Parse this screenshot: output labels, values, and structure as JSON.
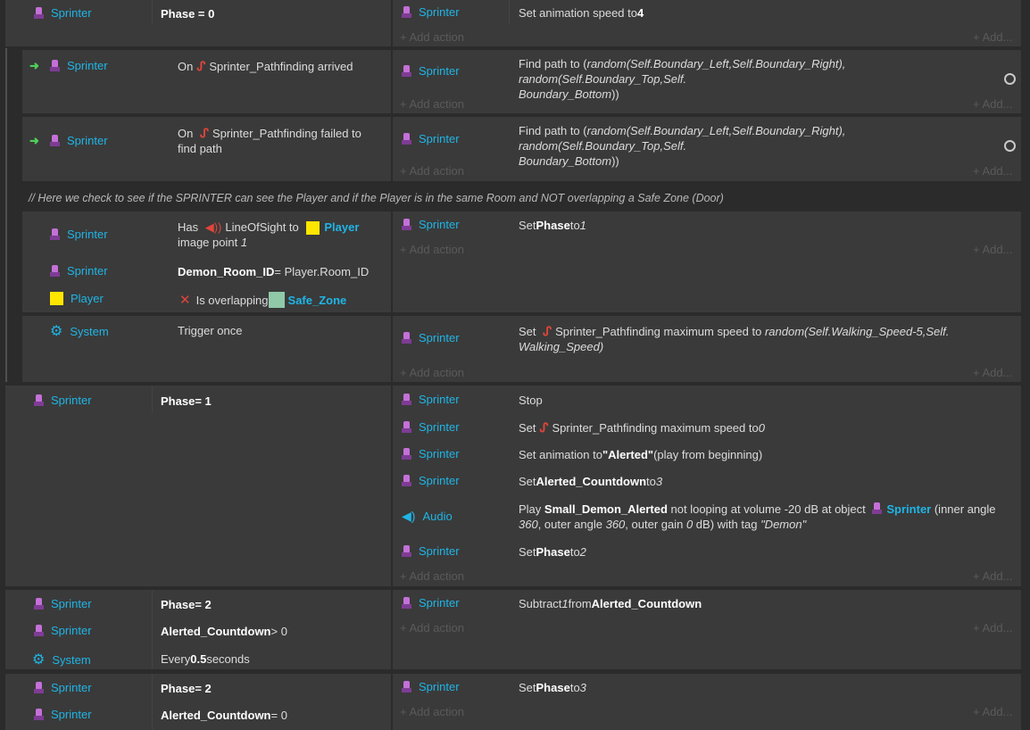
{
  "add_action": "+ Add action",
  "add_more": "+ Add...",
  "comment": "//  Here we check to see if the SPRINTER can see the Player and if the Player is in the same Room and NOT overlapping a Safe Zone (Door)",
  "objects": {
    "sprinter": "Sprinter",
    "player": "Player",
    "system": "System",
    "audio": "Audio"
  },
  "ev1": {
    "cond": "Phase = 0",
    "act": "Set animation speed to ",
    "act_val": "4"
  },
  "ev2": {
    "cond_pre": "On ",
    "cond_name": "Sprinter_Pathfinding arrived",
    "act": "Find path to (",
    "act_expr": "random(Self.Boundary_Left,Self.Boundary_Right), random(Self.Boundary_Top,Self.",
    "act_expr2": "Boundary_Bottom",
    "act_end": "))"
  },
  "ev3": {
    "cond_pre": "On ",
    "cond_name": "Sprinter_Pathfinding failed to",
    "cond_line2": "find path",
    "act": "Find path to (",
    "act_expr": "random(Self.Boundary_Left,Self.Boundary_Right), random(Self.Boundary_Top,Self.",
    "act_expr2": "Boundary_Bottom",
    "act_end": "))"
  },
  "ev4": {
    "c1_pre": "Has ",
    "c1_beh": "LineOfSight to ",
    "c1_obj": "Player",
    "c1_line2": "image point ",
    "c1_pt": "1",
    "c2_var": "Demon_Room_ID",
    "c2_rest": " = Player.Room_ID",
    "c3": "Is overlapping ",
    "c3_obj": "Safe_Zone",
    "a1_pre": "Set ",
    "a1_var": "Phase",
    "a1_mid": " to ",
    "a1_val": "1"
  },
  "ev5": {
    "cond": "Trigger once",
    "a_pre": "Set ",
    "a_name": "Sprinter_Pathfinding maximum speed to ",
    "a_expr": "random(Self.Walking_Speed-5,Self.",
    "a_expr2": "Walking_Speed)"
  },
  "ev6": {
    "cond_var": "Phase",
    "cond_rest": " = 1",
    "a1": "Stop",
    "a2_pre": "Set ",
    "a2_name": "Sprinter_Pathfinding maximum speed to ",
    "a2_val": "0",
    "a3_pre": "Set animation to ",
    "a3_val": "\"Alerted\"",
    "a3_post": " (play from beginning)",
    "a4_pre": "Set ",
    "a4_var": "Alerted_Countdown",
    "a4_mid": " to ",
    "a4_val": "3",
    "a5_pre": "Play ",
    "a5_snd": "Small_Demon_Alerted",
    "a5_mid": " not looping at volume -20 dB at object ",
    "a5_obj": "Sprinter",
    "a5_post": " (inner angle",
    "a5_l2a": "360",
    "a5_l2b": ", outer angle ",
    "a5_l2c": "360",
    "a5_l2d": ", outer gain ",
    "a5_l2e": "0",
    "a5_l2f": " dB) with tag ",
    "a5_l2g": "\"Demon\"",
    "a6_pre": "Set ",
    "a6_var": "Phase",
    "a6_mid": " to ",
    "a6_val": "2"
  },
  "ev7": {
    "c1_var": "Phase",
    "c1_rest": " = 2",
    "c2_var": "Alerted_Countdown",
    "c2_rest": " > 0",
    "c3_pre": "Every ",
    "c3_val": "0.5",
    "c3_post": " seconds",
    "a_pre": "Subtract ",
    "a_val": "1",
    "a_mid": " from ",
    "a_var": "Alerted_Countdown"
  },
  "ev8": {
    "c1_var": "Phase",
    "c1_rest": " = 2",
    "c2_var": "Alerted_Countdown",
    "c2_rest": " = 0",
    "a_pre": "Set ",
    "a_var": "Phase",
    "a_mid": " to ",
    "a_val": "3"
  }
}
